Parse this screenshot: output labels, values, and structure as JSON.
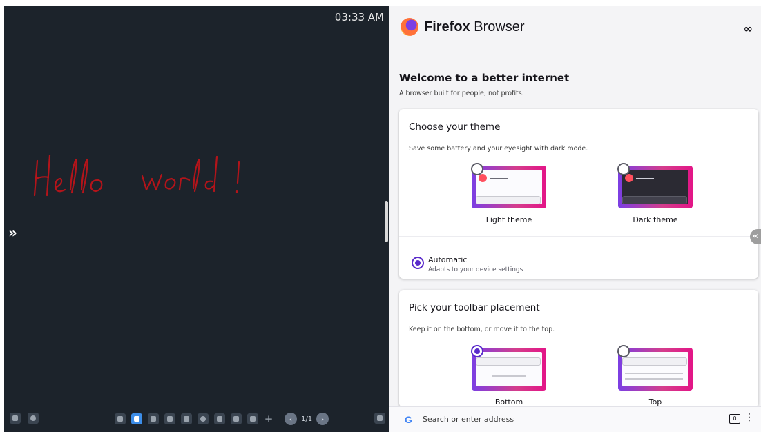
{
  "whiteboard": {
    "clock": "03:33 AM",
    "ink_text": "Hello world !",
    "ink_color": "#b3141a",
    "page_indicator": "1/1",
    "expand_glyph": "»"
  },
  "firefox": {
    "brand_bold": "Firefox",
    "brand_rest": " Browser",
    "private_icon": "∞",
    "welcome_title": "Welcome to a better internet",
    "welcome_sub": "A browser built for people, not profits.",
    "theme_card": {
      "title": "Choose your theme",
      "subtitle": "Save some battery and your eyesight with dark mode.",
      "light_label": "Light theme",
      "dark_label": "Dark theme",
      "auto_label": "Automatic",
      "auto_sub": "Adapts to your device settings"
    },
    "toolbar_card": {
      "title": "Pick your toolbar placement",
      "subtitle": "Keep it on the bottom, or move it to the top.",
      "bottom_label": "Bottom",
      "top_label": "Top"
    },
    "address_bar": {
      "google_glyph": "G",
      "placeholder": "Search or enter address",
      "tabs_count": "0",
      "menu_glyph": "⋮"
    },
    "side_tab_glyph": "«"
  },
  "colors": {
    "board_bg": "#1c232b",
    "accent": "#592acb",
    "active_tool": "#3c8de8"
  }
}
